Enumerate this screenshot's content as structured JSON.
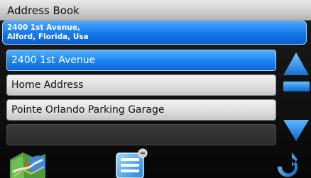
{
  "window": {
    "title": "Address Book"
  },
  "address": {
    "line1": "2400 1st Avenue,",
    "line2": "Alford, Florida, Usa"
  },
  "list": {
    "items": [
      {
        "label": "2400 1st Avenue",
        "selected": true
      },
      {
        "label": "Home Address",
        "selected": false
      },
      {
        "label": "Pointe Orlando Parking Garage",
        "selected": false
      },
      {
        "label": "",
        "selected": false
      }
    ]
  },
  "icons": {
    "scroll_up": "arrow-up-icon",
    "scroll_down": "arrow-down-icon",
    "map": "map-icon",
    "details": "list-details-icon",
    "back": "back-arrow-icon"
  },
  "colors": {
    "accent_blue": "#1e86f2",
    "row_gray": "#dcdcdc",
    "title_gray": "#cfcfcf",
    "background": "#101010"
  }
}
